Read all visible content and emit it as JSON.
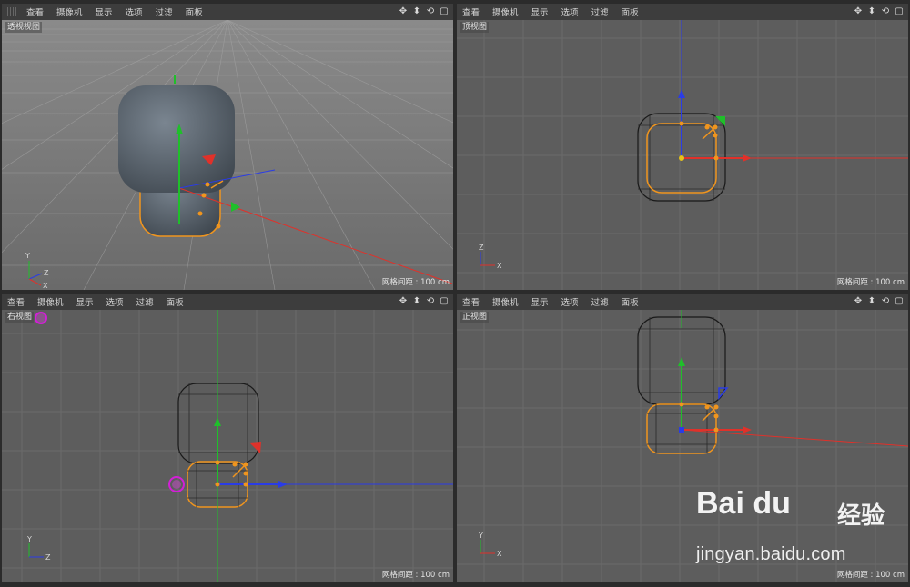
{
  "menu": [
    "查看",
    "摄像机",
    "显示",
    "选项",
    "过滤",
    "面板"
  ],
  "viewports": {
    "perspective": {
      "label": "透视视图",
      "grid": "网格间距 : 100 cm",
      "axis_y": "Y",
      "axis_z": "Z",
      "axis_x": "X"
    },
    "top": {
      "label": "顶视图",
      "grid": "网格间距 : 100 cm",
      "axis_y": "Z",
      "axis_x": "X"
    },
    "right": {
      "label": "右视图",
      "grid": "网格间距 : 100 cm",
      "axis_y": "Y",
      "axis_x": "Z"
    },
    "front": {
      "label": "正视图",
      "grid": "网格间距 : 100 cm",
      "axis_y": "Y",
      "axis_x": "X"
    }
  },
  "tool_icons": [
    "move-view-icon",
    "zoom-view-icon",
    "rotate-view-icon",
    "maximize-view-icon"
  ],
  "tool_glyphs": [
    "✥",
    "⬍",
    "⟲",
    "▢"
  ],
  "colors": {
    "x_axis": "#e0312a",
    "y_axis": "#1fbf2a",
    "z_axis": "#2a3ce6",
    "selection": "#f0951e",
    "marker": "#d21fd6"
  },
  "watermark": {
    "logo": "Bai du",
    "cn": "经验",
    "url": "jingyan.baidu.com"
  }
}
